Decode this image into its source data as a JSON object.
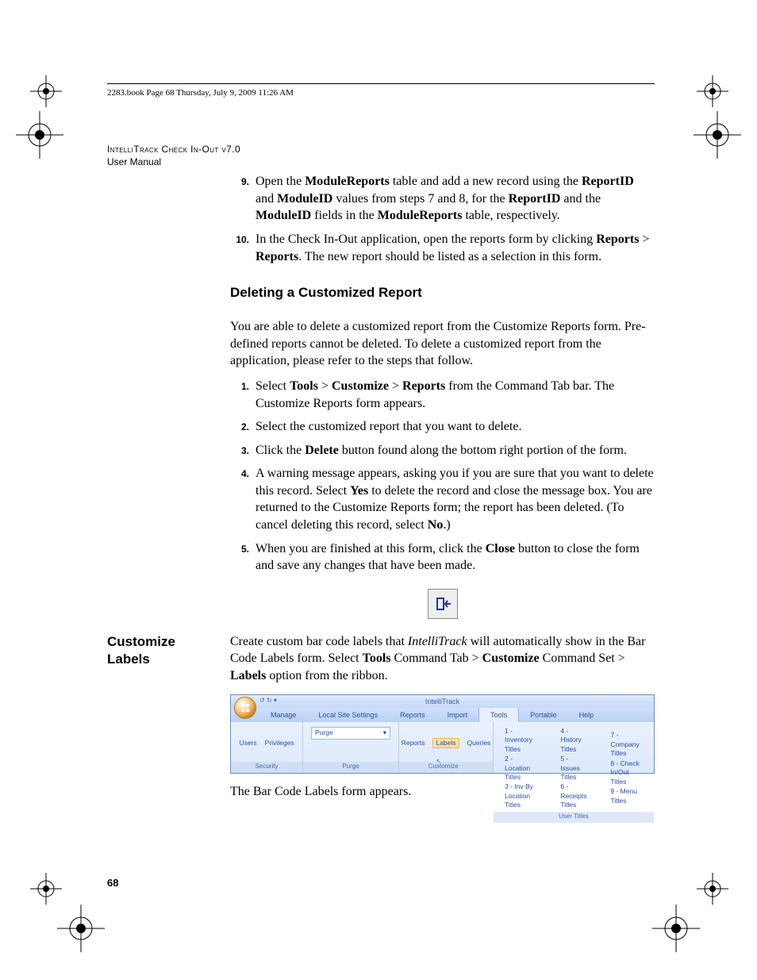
{
  "running_header": "2283.book  Page 68  Thursday, July 9, 2009  11:26 AM",
  "header": {
    "line1": "IntelliTrack Check In-Out v7.0",
    "line2": "User Manual"
  },
  "step9": {
    "num": "9.",
    "pre": "Open the ",
    "b1": "ModuleReports",
    "mid1": " table and add a new record using the ",
    "b2": "ReportID",
    "mid2": " and ",
    "b3": "ModuleID",
    "mid3": " values from steps 7 and 8, for the ",
    "b4": "ReportID",
    "mid4": " and the ",
    "b5": "ModuleID",
    "mid5": " fields in the ",
    "b6": "ModuleReports",
    "post": " table, respectively."
  },
  "step10": {
    "num": "10.",
    "pre": "In the Check In-Out application, open the reports form by clicking ",
    "b1": "Reports",
    "gt": " > ",
    "b2": "Reports",
    "post": ". The new report should be listed as a selection in this form."
  },
  "h_delete": "Deleting a Customized Report",
  "delete_intro": "You are able to delete a customized report from the Customize Reports form. Pre-defined reports cannot be deleted. To delete a customized report from the application, please refer to the steps that follow.",
  "d1": {
    "num": "1.",
    "pre": "Select ",
    "b1": "Tools",
    "gt1": " > ",
    "b2": "Customize",
    "gt2": " > ",
    "b3": "Reports",
    "post": " from the Command Tab bar. The Customize Reports form appears."
  },
  "d2": {
    "num": "2.",
    "text": "Select the customized report that you want to delete."
  },
  "d3": {
    "num": "3.",
    "pre": "Click the ",
    "b1": "Delete",
    "post": " button found along the bottom right portion of the form."
  },
  "d4": {
    "num": "4.",
    "pre": "A warning message appears, asking you if you are sure that you want to delete this record. Select ",
    "b1": "Yes",
    "mid": " to delete the record and close the message box. You are returned to the Customize Reports form; the report has been deleted. (To cancel deleting this record, select ",
    "b2": "No",
    "post": ".)"
  },
  "d5": {
    "num": "5.",
    "pre": "When you are finished at this form, click the ",
    "b1": "Close",
    "post": " button to close the form and save any changes that have been made."
  },
  "side_heading": "Customize Labels",
  "labels_para": {
    "pre": "Create custom bar code labels that ",
    "i1": "IntelliTrack",
    " mid1": " will automatically show in the Bar Code Labels form. Select ",
    "b1": "Tools",
    "mid2": " Command Tab > ",
    "b2": "Customize",
    "mid3": " Command Set > ",
    "b3": "Labels",
    "post": " option from the ribbon."
  },
  "labels_after": "The Bar Code Labels form appears.",
  "page_number": "68",
  "ribbon": {
    "app_title": "IntelliTrack",
    "tabs": [
      "Manage",
      "Local Site Settings",
      "Reports",
      "Import",
      "Tools",
      "Portable",
      "Help"
    ],
    "active_tab_index": 4,
    "groups": {
      "security": {
        "items": [
          "Users",
          "Privileges"
        ],
        "label": "Security"
      },
      "purge": {
        "combo": "Purge",
        "label": "Purge"
      },
      "customize": {
        "items": [
          "Reports",
          "Labels",
          "Queries"
        ],
        "highlight_index": 1,
        "label": "Customize"
      },
      "usertitles": {
        "col1": [
          "1 - Inventory Titles",
          "2 - Location Titles",
          "3 - Inv By Location Titles"
        ],
        "col2": [
          "4 - History Titles",
          "5 - Issues Titles",
          "6 - Receipts Titles"
        ],
        "col3": [
          "7 - Company Titles",
          "8 - Check In/Out Titles",
          "9 - Menu Titles"
        ],
        "label": "User Titles"
      }
    }
  }
}
